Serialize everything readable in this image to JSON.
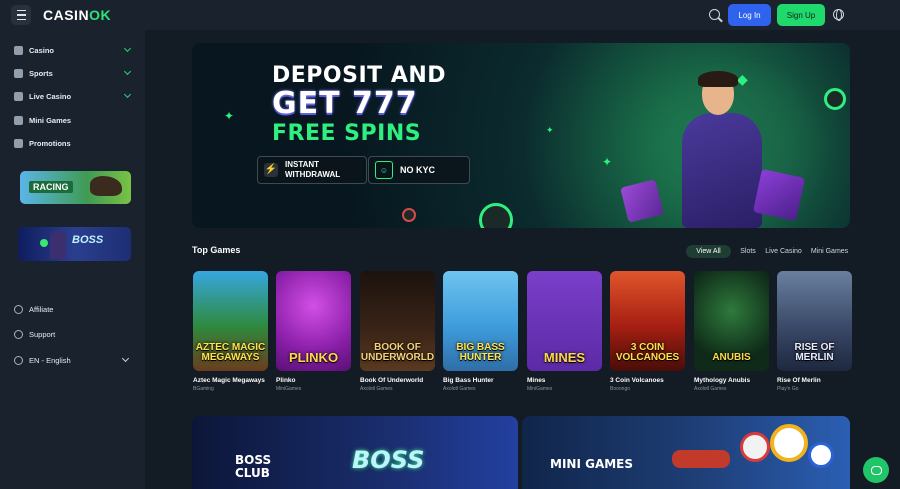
{
  "header": {
    "logo_main": "CASIN",
    "logo_accent": "OK",
    "login_label": "Log In",
    "signup_label": "Sign Up"
  },
  "sidebar": {
    "items": [
      {
        "label": "Casino",
        "icon": "casino-icon"
      },
      {
        "label": "Sports",
        "icon": "sports-icon"
      },
      {
        "label": "Live Casino",
        "icon": "live-casino-icon"
      },
      {
        "label": "Mini Games",
        "icon": "rocket-icon"
      },
      {
        "label": "Promotions",
        "icon": "gift-icon"
      }
    ],
    "promo_racing": "RACING",
    "promo_boss": "BOSS",
    "bottom": {
      "affiliate": "Affiliate",
      "support": "Support",
      "language": "EN - English"
    }
  },
  "hero": {
    "line1": "DEPOSIT AND",
    "line2": "GET 777",
    "line3": "FREE SPINS",
    "badge1_line1": "INSTANT",
    "badge1_line2": "WITHDRAWAL",
    "badge2": "NO KYC"
  },
  "top_games": {
    "title": "Top Games",
    "filters": [
      "View All",
      "Slots",
      "Live Casino",
      "Mini Games"
    ],
    "games": [
      {
        "name": "Aztec Magic Megaways",
        "provider": "BGaming",
        "art": "AZTEC MAGIC MEGAWAYS"
      },
      {
        "name": "Plinko",
        "provider": "MiniGames",
        "art": "PLINKO"
      },
      {
        "name": "Book Of Underworld",
        "provider": "Axolotl Games",
        "art": "BOOK OF UNDERWORLD"
      },
      {
        "name": "Big Bass Hunter",
        "provider": "Axolotl Games",
        "art": "BIG BASS HUNTER"
      },
      {
        "name": "Mines",
        "provider": "MiniGames",
        "art": "MINES"
      },
      {
        "name": "3 Coin Volcanoes",
        "provider": "Booongo",
        "art": "3 COIN VOLCANOES"
      },
      {
        "name": "Mythology Anubis",
        "provider": "Axolotl Games",
        "art": "ANUBIS"
      },
      {
        "name": "Rise Of Merlin",
        "provider": "Play'n Go",
        "art": "RISE OF MERLIN"
      }
    ]
  },
  "banners": {
    "boss_club": "BOSS CLUB",
    "boss_logo": "BOSS",
    "mini_games": "MINI GAMES"
  }
}
